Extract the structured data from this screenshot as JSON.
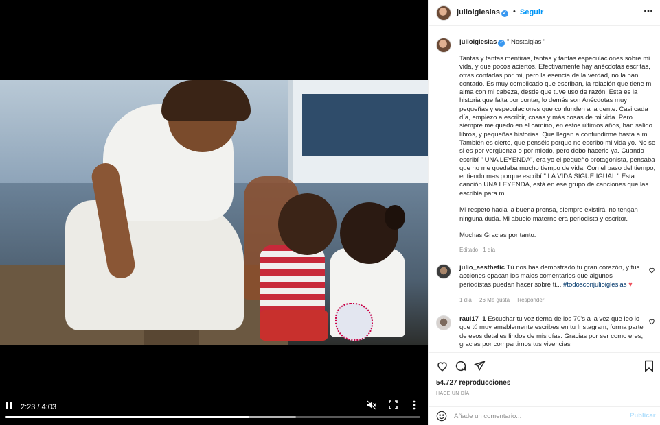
{
  "video": {
    "current_time": "2:23",
    "duration": "4:03",
    "separator": "/",
    "progress_fraction": 0.588,
    "buffered_fraction": 0.7,
    "icons": {
      "play_pause": "pause-icon",
      "mute": "muted-speaker-icon",
      "fullscreen": "fullscreen-icon",
      "more": "vertical-dots-icon"
    }
  },
  "header": {
    "username": "julioiglesias",
    "verified": true,
    "dot": "•",
    "follow_label": "Seguir"
  },
  "caption": {
    "username": "julioiglesias",
    "title": "\" Nostalgias \"",
    "body": "Tantas y tantas mentiras, tantas y tantas especulaciones sobre mi vida, y que pocos aciertos. Efectivamente hay anécdotas escritas, otras contadas por mi, pero la esencia de la verdad, no la han contado. Es muy complicado que escriban, la relación que tiene mi alma con mi cabeza, desde que tuve uso de razón. Esta es la historia que falta por contar, lo demás son Anécdotas muy pequeñas y especulaciones que confunden a la gente. Casi cada día, empiezo a escribir, cosas y más cosas de mi vida. Pero siempre me quedo en el camino, en estos últimos años, han salido libros, y pequeñas historias. Que llegan a confundirme hasta a mi. También es cierto, que penséis porque no escribo mi vida yo. No se si es por vergüenza o por miedo, pero debo hacerlo ya. Cuando escribí \" UNA LEYENDA\", era yo el pequeño protagonista, pensaba que no me quedaba mucho tiempo de vida. Con el paso del tiempo, entiendo mas porque escribí \" LA VIDA SIGUE IGUAL.\" Esta canción UNA LEYENDA, está en ese grupo de canciones que las escribía para mi.\n\nMi respeto hacia la buena prensa, siempre existirá, no tengan ninguna duda. Mi abuelo materno era periodista y escritor.\n\nMuchas Gracias por tanto.",
    "meta": "Editado · 1 día"
  },
  "comments": [
    {
      "username": "julio_aesthetic",
      "text": "Tú nos has demostrado tu gran corazón, y tus acciones opacan los malos comentarios que algunos periodistas puedan hacer sobre ti...",
      "hashtag": "#todosconjulioiglesias",
      "heart": "♥",
      "age": "1 día",
      "likes": "26 Me gusta",
      "reply_label": "Responder"
    },
    {
      "username": "raul17_1",
      "text": "Escuchar tu voz tierna de los 70's a la vez que leo lo que tú muy amablemente escribes en tu Instagram, forma parte de esos detalles lindos de mis días. Gracias por ser como eres, gracias por compartirnos tus vivencias"
    }
  ],
  "actions": {
    "icons": [
      "heart-icon",
      "comment-icon",
      "share-icon",
      "bookmark-icon"
    ],
    "views": "54.727 reproducciones",
    "date": "HACE UN DÍA"
  },
  "add_comment": {
    "placeholder": "Añade un comentario...",
    "publish_label": "Publicar",
    "emoji_icon": "emoji-icon"
  },
  "colors": {
    "accent": "#0095f6",
    "publish_disabled": "#b2dffc",
    "heart_red": "#ed4956",
    "muted_text": "#8e8e8e"
  }
}
